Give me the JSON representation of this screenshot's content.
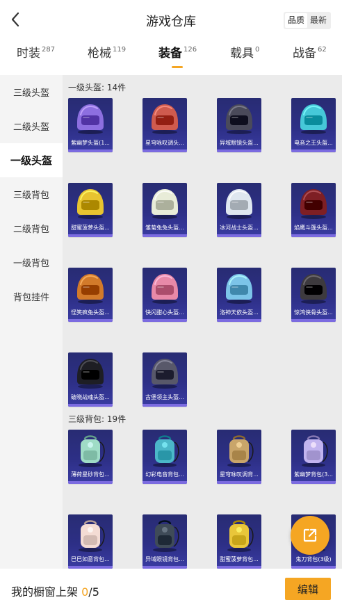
{
  "header": {
    "title": "游戏仓库",
    "sort_options": [
      "品质",
      "最新"
    ],
    "sort_active": "品质"
  },
  "categories": [
    {
      "label": "时装",
      "count": "287"
    },
    {
      "label": "枪械",
      "count": "119"
    },
    {
      "label": "装备",
      "count": "126"
    },
    {
      "label": "载具",
      "count": "0"
    },
    {
      "label": "战备",
      "count": "62"
    }
  ],
  "active_category": "装备",
  "sidebar": {
    "items": [
      "三级头盔",
      "二级头盔",
      "一级头盔",
      "三级背包",
      "二级背包",
      "一级背包",
      "背包挂件"
    ],
    "active": "一级头盔"
  },
  "sections": [
    {
      "title": "一级头盔: 14件",
      "items": [
        {
          "name": "紫幽梦头盔(1...",
          "icon": "helmet-icon",
          "color": "#8d6fe0"
        },
        {
          "name": "星穹咏叹调头...",
          "icon": "helmet-icon",
          "color": "#cf5b4e"
        },
        {
          "name": "异域眼镜头盔...",
          "icon": "helmet-icon",
          "color": "#4a4a5a"
        },
        {
          "name": "电音之王头盔...",
          "icon": "helmet-icon",
          "color": "#46c8d8"
        },
        {
          "name": "甜蜜菠萝头盔...",
          "icon": "helmet-icon",
          "color": "#e8c430"
        },
        {
          "name": "雏菊兔兔头盔...",
          "icon": "helmet-icon",
          "color": "#e8ecd8"
        },
        {
          "name": "冰河战士头盔...",
          "icon": "helmet-icon",
          "color": "#dfe7ef"
        },
        {
          "name": "焰鹰斗篷头盔...",
          "icon": "helmet-icon",
          "color": "#7e1f24"
        },
        {
          "name": "怪笑疯兔头盔...",
          "icon": "helmet-icon",
          "color": "#d27a2a"
        },
        {
          "name": "快闪甜心头盔...",
          "icon": "helmet-icon",
          "color": "#e889a8"
        },
        {
          "name": "洛神天依头盔...",
          "icon": "helmet-icon",
          "color": "#7cc4e8"
        },
        {
          "name": "惊鸿侠骨头盔...",
          "icon": "helmet-icon",
          "color": "#3d3a3e"
        },
        {
          "name": "破晓战魂头盔...",
          "icon": "helmet-icon",
          "color": "#1e1e24"
        },
        {
          "name": "古堡领主头盔...",
          "icon": "helmet-icon",
          "color": "#58586a"
        }
      ]
    },
    {
      "title": "三级背包: 19件",
      "items": [
        {
          "name": "薄荷星砂背包...",
          "icon": "backpack-icon",
          "color": "#9fdcc6"
        },
        {
          "name": "幻彩电音背包...",
          "icon": "backpack-icon",
          "color": "#4bb7c9"
        },
        {
          "name": "星穹咏叹调背...",
          "icon": "backpack-icon",
          "color": "#c9a56a"
        },
        {
          "name": "紫幽梦背包(3...",
          "icon": "backpack-icon",
          "color": "#c2b4ef"
        },
        {
          "name": "巳巳如意背包...",
          "icon": "backpack-icon",
          "color": "#f4dcd4"
        },
        {
          "name": "异域眼镜背包...",
          "icon": "backpack-icon",
          "color": "#3f4b58"
        },
        {
          "name": "甜蜜菠萝背包...",
          "icon": "backpack-icon",
          "color": "#e9c63a"
        },
        {
          "name": "鬼刀背包(3级)",
          "icon": "backpack-icon",
          "color": "#1f3a64"
        }
      ]
    }
  ],
  "footer": {
    "label": "我的橱窗上架",
    "count_current": "0",
    "count_total": "/5",
    "edit_label": "编辑"
  },
  "colors": {
    "accent": "#f5a623",
    "card_bg": "#2d2f86",
    "card_bar": "#7b6be0"
  }
}
